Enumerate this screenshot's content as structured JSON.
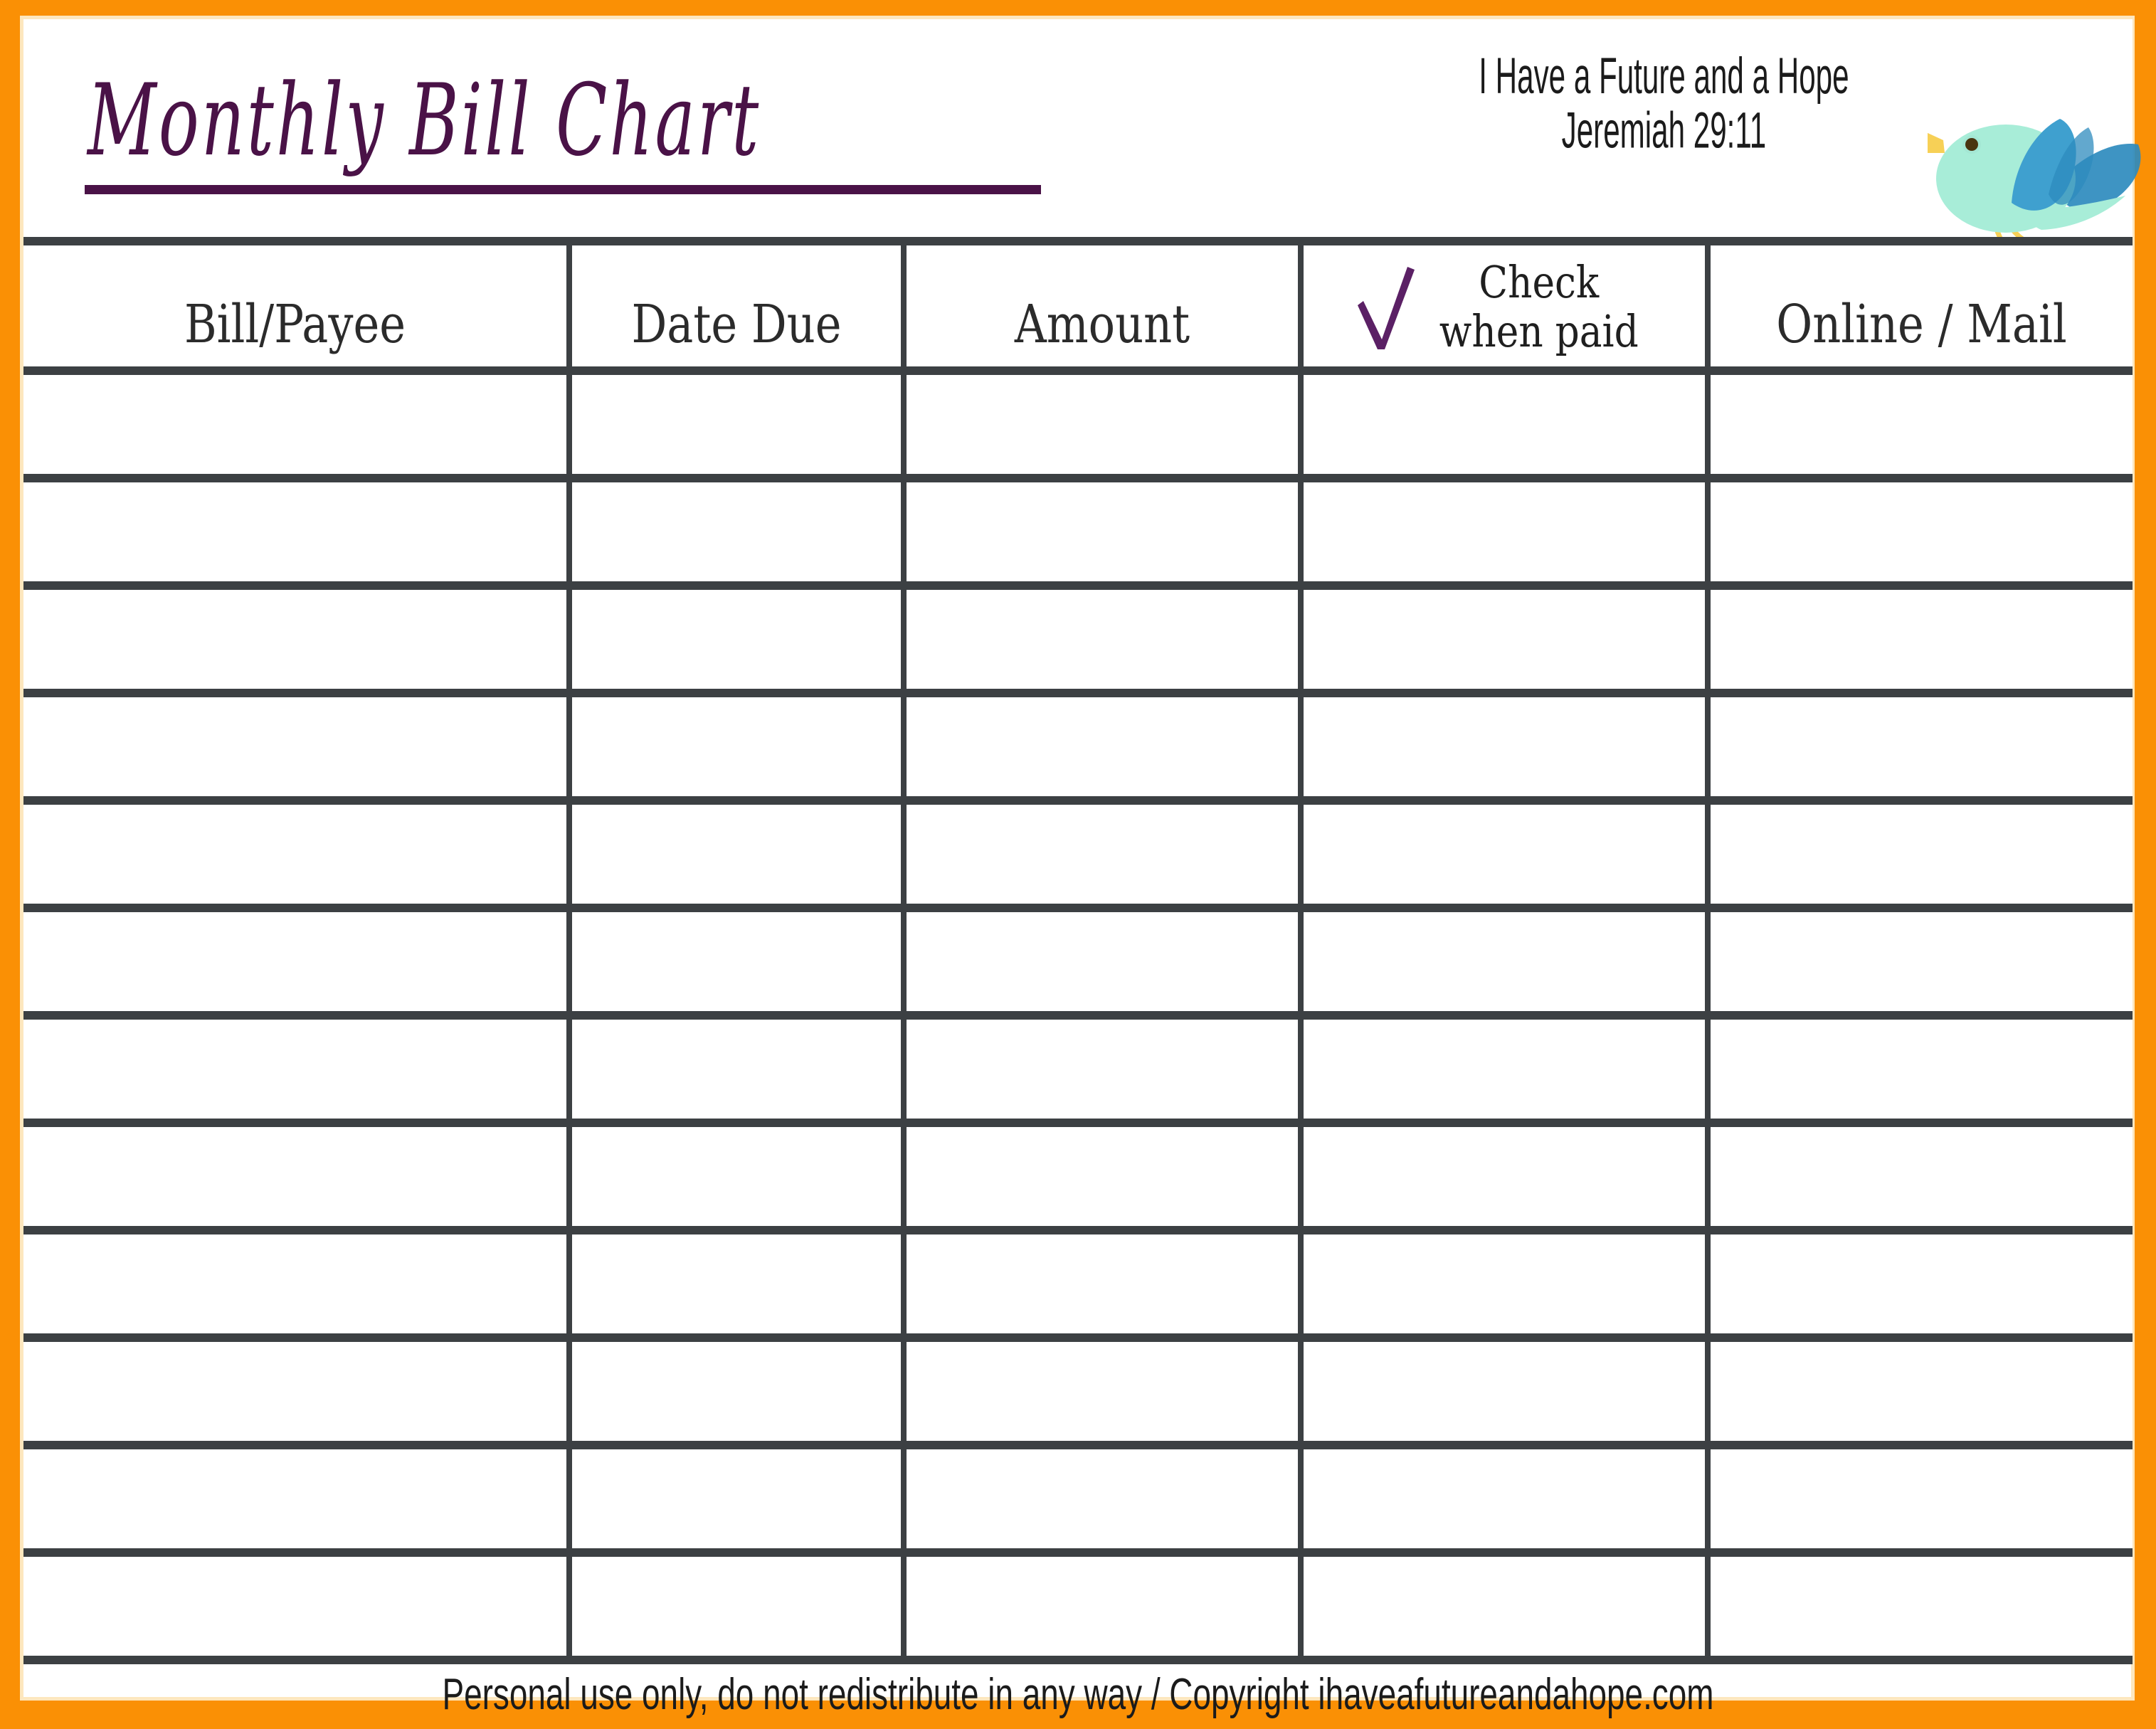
{
  "document": {
    "title": "Monthly Bill Chart",
    "tagline_line1": "I Have a Future and a Hope",
    "tagline_line2": "Jeremiah 29:11",
    "footer": "Personal use only, do not redistribute in any way / Copyright ihaveafutureandahope.com"
  },
  "colors": {
    "frame_orange": "#FA9005",
    "frame_inner": "#FDE7BE",
    "title_purple": "#4A1247",
    "check_purple": "#5B2065",
    "grid_line": "#3C4043",
    "text_dark": "#1f1f1f",
    "bird_body": "#A8EDD8",
    "bird_wing_front": "#3FA0CF",
    "bird_wing_back": "#2E8BBE",
    "bird_beak": "#F7D056"
  },
  "icons": {
    "checkmark": "check-mark-icon",
    "bird": "bird-illustration"
  },
  "table": {
    "columns": [
      {
        "key": "bill",
        "label": "Bill/Payee"
      },
      {
        "key": "date",
        "label": "Date Due"
      },
      {
        "key": "amount",
        "label": "Amount"
      },
      {
        "key": "check",
        "label_line1": "Check",
        "label_line2": "when paid"
      },
      {
        "key": "online",
        "label": "Online / Mail"
      }
    ],
    "row_count": 12,
    "rows": [
      {
        "bill": "",
        "date": "",
        "amount": "",
        "check": "",
        "online": ""
      },
      {
        "bill": "",
        "date": "",
        "amount": "",
        "check": "",
        "online": ""
      },
      {
        "bill": "",
        "date": "",
        "amount": "",
        "check": "",
        "online": ""
      },
      {
        "bill": "",
        "date": "",
        "amount": "",
        "check": "",
        "online": ""
      },
      {
        "bill": "",
        "date": "",
        "amount": "",
        "check": "",
        "online": ""
      },
      {
        "bill": "",
        "date": "",
        "amount": "",
        "check": "",
        "online": ""
      },
      {
        "bill": "",
        "date": "",
        "amount": "",
        "check": "",
        "online": ""
      },
      {
        "bill": "",
        "date": "",
        "amount": "",
        "check": "",
        "online": ""
      },
      {
        "bill": "",
        "date": "",
        "amount": "",
        "check": "",
        "online": ""
      },
      {
        "bill": "",
        "date": "",
        "amount": "",
        "check": "",
        "online": ""
      },
      {
        "bill": "",
        "date": "",
        "amount": "",
        "check": "",
        "online": ""
      },
      {
        "bill": "",
        "date": "",
        "amount": "",
        "check": "",
        "online": ""
      }
    ]
  }
}
